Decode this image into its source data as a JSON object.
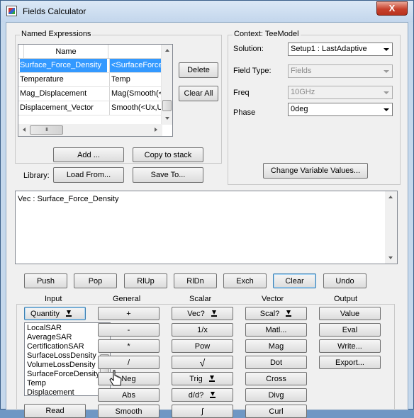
{
  "window": {
    "title": "Fields Calculator",
    "close_glyph": "X"
  },
  "named_expressions": {
    "group_label": "Named Expressions",
    "column_header": "Name",
    "rows": [
      {
        "name": "Surface_Force_Density",
        "expr": "<SurfaceForce"
      },
      {
        "name": "Temperature",
        "expr": "Temp"
      },
      {
        "name": "Mag_Displacement",
        "expr": "Mag(Smooth(<U"
      },
      {
        "name": "Displacement_Vector",
        "expr": "Smooth(<Ux,Uy"
      }
    ],
    "hscroll_grip": "III",
    "delete_label": "Delete",
    "clear_all_label": "Clear All",
    "add_label": "Add ...",
    "copy_to_stack_label": "Copy to stack",
    "library_label": "Library:",
    "load_from_label": "Load From...",
    "save_to_label": "Save To..."
  },
  "context": {
    "group_label": "Context: TeeModel",
    "solution_label": "Solution:",
    "solution_value": "Setup1 : LastAdaptive",
    "field_type_label": "Field Type:",
    "field_type_value": "Fields",
    "freq_label": "Freq",
    "freq_value": "10GHz",
    "phase_label": "Phase",
    "phase_value": "0deg",
    "change_vars_label": "Change Variable Values..."
  },
  "stack": {
    "text": "Vec : Surface_Force_Density"
  },
  "stack_buttons": [
    "Push",
    "Pop",
    "RlUp",
    "RlDn",
    "Exch",
    "Clear",
    "Undo"
  ],
  "columns": {
    "input": "Input",
    "general": "General",
    "scalar": "Scalar",
    "vector": "Vector",
    "output": "Output"
  },
  "input": {
    "quantity_label": "Quantity",
    "list_items": [
      "LocalSAR",
      "AverageSAR",
      "CertificationSAR",
      "SurfaceLossDensity",
      "VolumeLossDensity",
      "SurfaceForceDensity",
      "Temp",
      "Displacement"
    ],
    "read_label": "Read"
  },
  "general": {
    "buttons": [
      "+",
      "-",
      "*",
      "/",
      "Neg",
      "Abs"
    ],
    "smooth_label": "Smooth"
  },
  "scalar": {
    "buttons": [
      "Vec?",
      "1/x",
      "Pow",
      "√",
      "Trig",
      "d/d?"
    ],
    "integral_label": "∫"
  },
  "vector": {
    "buttons": [
      "Scal?",
      "Matl...",
      "Mag",
      "Dot",
      "Cross",
      "Divg"
    ],
    "curl_label": "Curl"
  },
  "output": {
    "buttons": [
      "Value",
      "Eval",
      "Write...",
      "Export..."
    ]
  }
}
